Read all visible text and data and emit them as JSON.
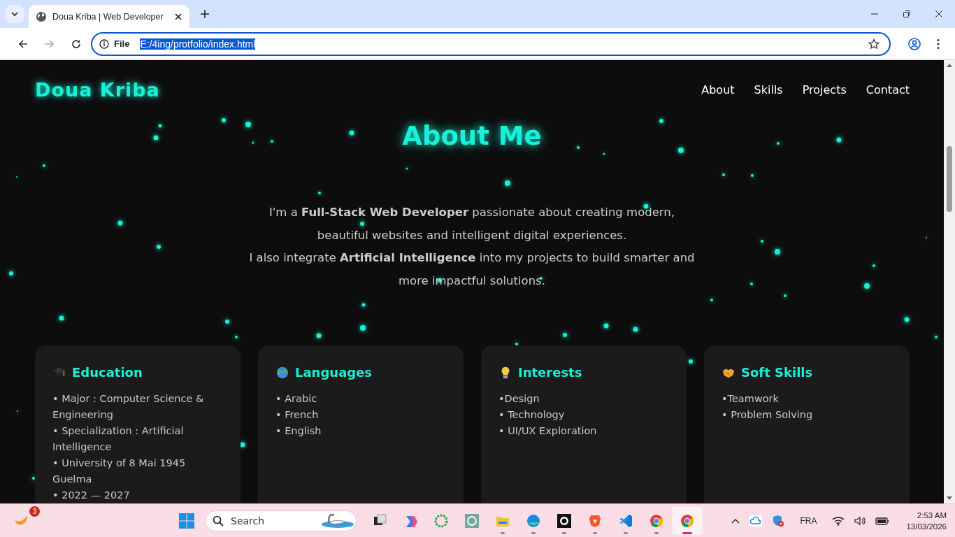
{
  "browser": {
    "tab": {
      "title": "Doua Kriba | Web Developer"
    },
    "address": {
      "scheme": "File",
      "url": "E:/4ing/protfolio/index.html",
      "selected": true
    }
  },
  "site": {
    "logo": "Doua Kriba",
    "nav": [
      "About",
      "Skills",
      "Projects",
      "Contact"
    ],
    "heading": "About Me",
    "intro": [
      "I'm a **Full-Stack Web Developer** passionate about creating modern, beautiful websites and intelligent digital experiences.",
      "I also integrate **Artificial Intelligence** into my projects to build smarter and more impactful solutions."
    ],
    "cards": [
      {
        "title": "Education",
        "items": [
          "• Major : Computer Science & Engineering",
          "• Specialization : Artificial Intelligence",
          "• University of 8 Mai 1945 Guelma",
          "• 2022 — 2027"
        ]
      },
      {
        "title": "Languages",
        "items": [
          "• Arabic",
          "• French",
          "• English"
        ]
      },
      {
        "title": "Interests",
        "items": [
          "•Design",
          "• Technology",
          "• UI/UX Exploration"
        ]
      },
      {
        "title": "Soft Skills",
        "items": [
          "•Teamwork",
          "• Problem Solving"
        ]
      }
    ]
  },
  "taskbar": {
    "weather_badge": "3",
    "search": {
      "placeholder": "Search"
    },
    "apps": [
      {
        "running": false,
        "selected": false
      },
      {
        "running": false,
        "selected": false
      },
      {
        "running": false,
        "selected": false
      },
      {
        "running": false,
        "selected": false
      },
      {
        "running": true,
        "selected": false
      },
      {
        "running": true,
        "selected": false
      },
      {
        "running": true,
        "selected": false
      },
      {
        "running": true,
        "selected": false
      },
      {
        "running": true,
        "selected": false
      },
      {
        "running": true,
        "selected": false
      },
      {
        "running": true,
        "selected": true
      }
    ],
    "language": "FRA",
    "time": "2:53 AM",
    "date": "13/03/2026"
  }
}
